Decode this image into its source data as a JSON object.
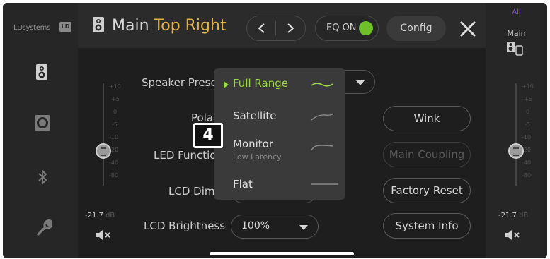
{
  "brand": {
    "name": "LDsystems",
    "logo_text": "LD"
  },
  "header": {
    "title_main": "Main",
    "title_accent": "Top Right",
    "eq_label": "EQ ON",
    "config_label": "Config"
  },
  "right_rail": {
    "group_label": "All",
    "channel_label": "Main"
  },
  "left_fader": {
    "ticks": [
      "+10",
      "+5",
      "0",
      "-5",
      "-10",
      "-20",
      "-40",
      "-80"
    ],
    "level_value": "-21.7",
    "level_unit": "dB",
    "level_fraction": 0.66
  },
  "right_fader": {
    "ticks": [
      "+10",
      "+5",
      "0",
      "-5",
      "-10",
      "-20",
      "-40",
      "-80"
    ],
    "level_value": "-21.7",
    "level_unit": "dB",
    "level_fraction": 0.66
  },
  "settings": {
    "speaker_preset_label": "Speaker Prese",
    "polarity_label": "Pola",
    "led_function_label": "LED Functio",
    "lcd_dimmer_label": "LCD Dimm",
    "lcd_brightness_label": "LCD Brightness",
    "lcd_brightness_value": "100%"
  },
  "buttons": {
    "wink": "Wink",
    "main_coupling": "Main Coupling",
    "factory_reset": "Factory Reset",
    "system_info": "System Info"
  },
  "preset_dropdown": {
    "options": [
      {
        "label": "Full Range",
        "sub": "",
        "selected": true
      },
      {
        "label": "Satellite",
        "sub": "",
        "selected": false
      },
      {
        "label": "Monitor",
        "sub": "Low Latency",
        "selected": false
      },
      {
        "label": "Flat",
        "sub": "",
        "selected": false
      }
    ]
  },
  "annotation_badge": "4",
  "colors": {
    "accent": "#e1b24a",
    "selected": "#9bd84a",
    "eq_on": "#6fbf2a",
    "group": "#8b54d8"
  },
  "icons": {
    "left_rail": [
      "speaker-cabinet-icon",
      "subwoofer-icon",
      "bluetooth-icon",
      "wrench-icon"
    ],
    "header": [
      "speaker-cabinet-icon",
      "chevron-left-icon",
      "chevron-right-icon",
      "close-icon"
    ],
    "right_rail": "linked-speakers-icon",
    "mute": "mute-speaker-icon"
  }
}
